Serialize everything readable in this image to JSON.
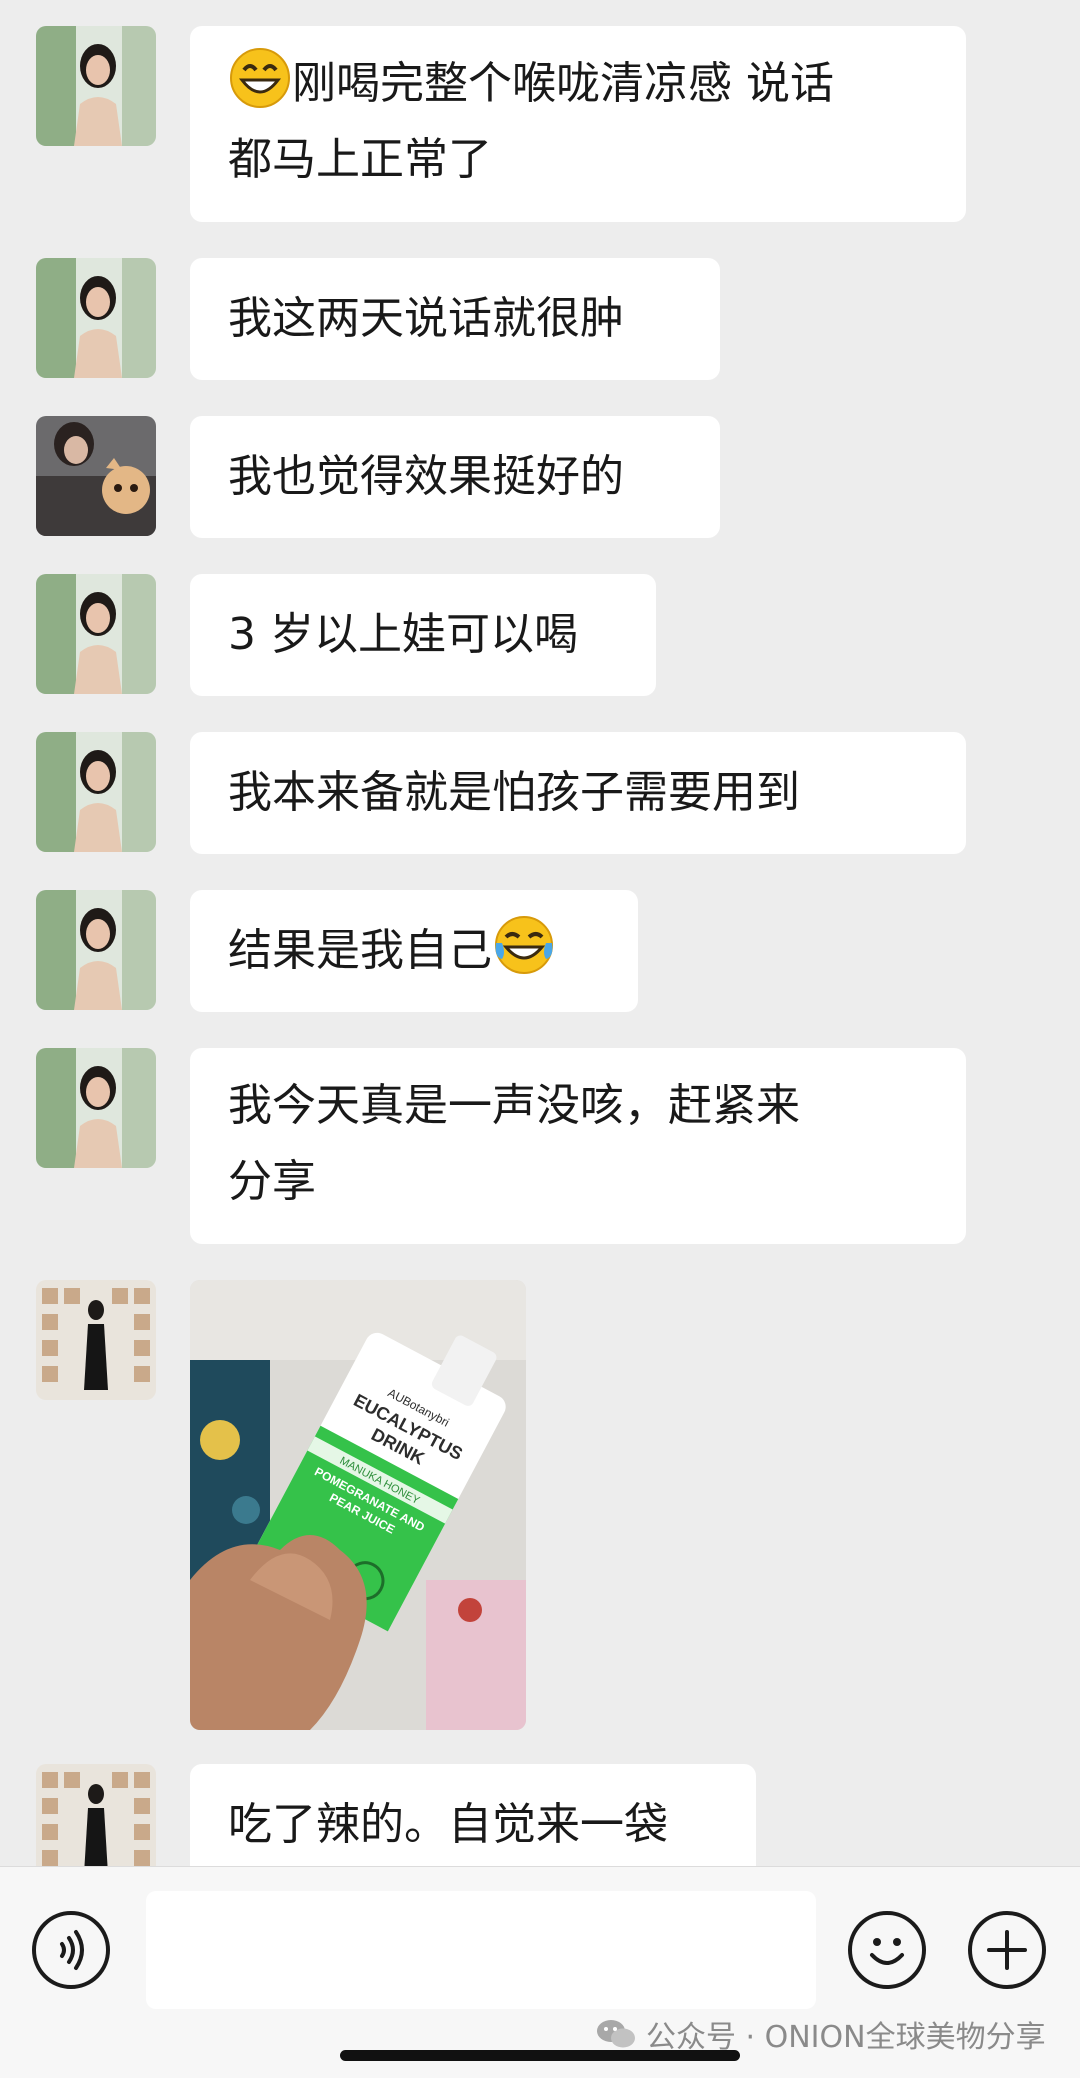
{
  "messages": [
    {
      "lines": [
        "刚喝完整个喉咙清凉感 说话",
        "都马上正常了"
      ],
      "emoji": "grinning-face-icon"
    },
    {
      "lines": [
        "我这两天说话就很肿"
      ]
    },
    {
      "lines": [
        "我也觉得效果挺好的"
      ]
    },
    {
      "lines": [
        "3 岁以上娃可以喝"
      ]
    },
    {
      "lines": [
        "我本来备就是怕孩子需要用到"
      ]
    },
    {
      "lines": [
        "结果是我自己"
      ],
      "emoji_after": "tears-of-joy-icon"
    },
    {
      "lines": [
        "我今天真是一声没咳，赶紧来",
        "分享"
      ]
    },
    {
      "type": "image",
      "product": {
        "brand": "AUBotanybri",
        "name_line1": "EUCALYPTUS",
        "name_line2": "DRINK",
        "flavor": "MANUKA HONEY",
        "sub1": "POMEGRANATE AND",
        "sub2": "PEAR JUICE"
      }
    },
    {
      "lines": [
        "吃了辣的。自觉来一袋"
      ]
    }
  ],
  "input_bar": {
    "voice_icon": "voice-icon",
    "emoji_icon": "smiley-icon",
    "plus_icon": "plus-icon",
    "input_value": ""
  },
  "watermark": {
    "icon": "wechat-icon",
    "text": "公众号 · ONION全球美物分享"
  },
  "colors": {
    "background": "#ededed",
    "bubble": "#ffffff",
    "text": "#191919"
  }
}
